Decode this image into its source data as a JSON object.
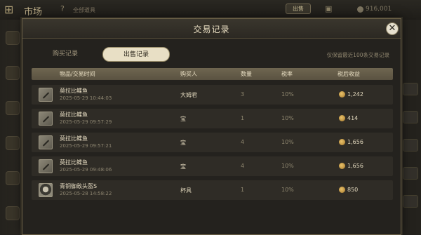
{
  "background": {
    "app_title": "市场",
    "help_mark": "?",
    "sub_label": "全部道具",
    "top_button": "出售",
    "coins": "916,001"
  },
  "dialog": {
    "title": "交易记录",
    "close_label": "✕",
    "tabs": [
      {
        "label": "购买记录",
        "active": false
      },
      {
        "label": "出售记录",
        "active": true
      }
    ],
    "hint": "仅保留最近100条交易记录",
    "columns": [
      "物品/交易时间",
      "购买人",
      "数量",
      "税率",
      "税后收益"
    ],
    "rows": [
      {
        "name": "莫拉比鲽鱼",
        "time": "2025-05-29 10:44:03",
        "buyer": "大姆君",
        "qty": "3",
        "tax": "10%",
        "income": "1,242",
        "icon": "fish-icon"
      },
      {
        "name": "莫拉比鲽鱼",
        "time": "2025-05-29 09:57:29",
        "buyer": "宝",
        "qty": "1",
        "tax": "10%",
        "income": "414",
        "icon": "fish-icon"
      },
      {
        "name": "莫拉比鲽鱼",
        "time": "2025-05-29 09:57:21",
        "buyer": "宝",
        "qty": "4",
        "tax": "10%",
        "income": "1,656",
        "icon": "fish-icon"
      },
      {
        "name": "莫拉比鲽鱼",
        "time": "2025-05-29 09:48:06",
        "buyer": "宝",
        "qty": "4",
        "tax": "10%",
        "income": "1,656",
        "icon": "fish-icon"
      },
      {
        "name": "青铜御敌头盔S",
        "time": "2025-05-28 14:58:22",
        "buyer": "杯具",
        "qty": "1",
        "tax": "10%",
        "income": "850",
        "icon": "helmet-icon"
      }
    ]
  },
  "colors": {
    "panel": "#24221e",
    "header_bar": "#6f6650",
    "active_tab": "#e8dfc5",
    "coin": "#e9c26a"
  }
}
